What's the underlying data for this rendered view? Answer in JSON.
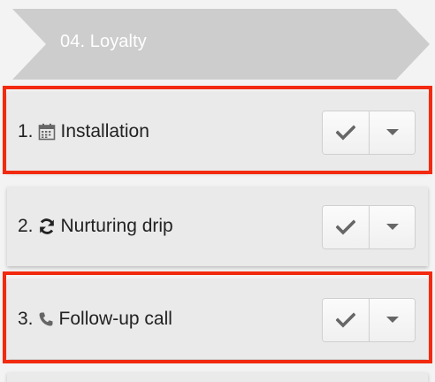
{
  "stage": {
    "title": "04. Loyalty"
  },
  "tasks": [
    {
      "number": "1.",
      "icon": "calendar-icon",
      "label": "Installation",
      "highlighted": true
    },
    {
      "number": "2.",
      "icon": "refresh-icon",
      "label": "Nurturing drip",
      "highlighted": false
    },
    {
      "number": "3.",
      "icon": "phone-icon",
      "label": "Follow-up call",
      "highlighted": true
    }
  ],
  "colors": {
    "chevron": "#cdcdcd",
    "card": "#eaeaea",
    "highlight": "#f22a0f",
    "icon": "#666666"
  }
}
